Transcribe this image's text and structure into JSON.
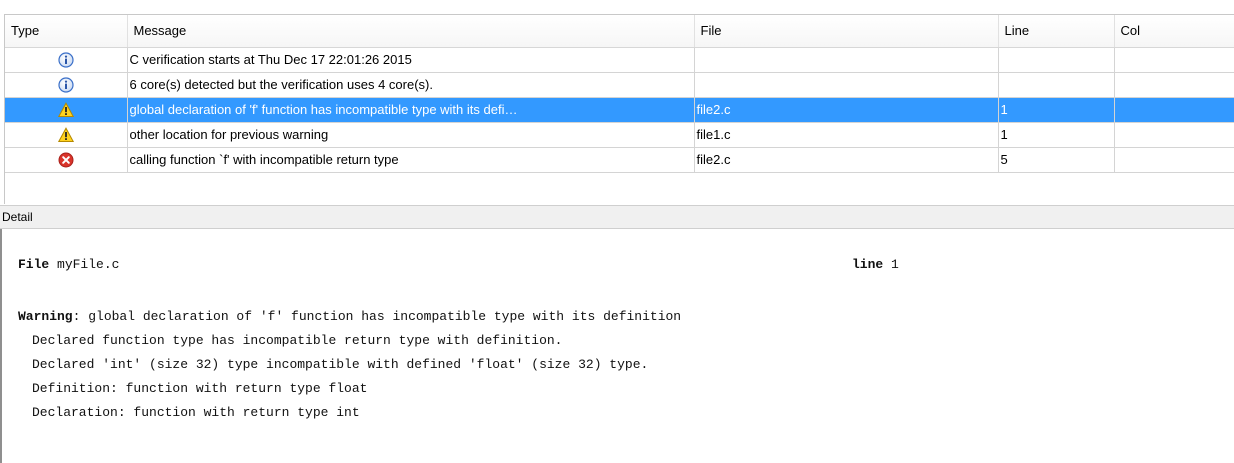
{
  "table": {
    "headers": {
      "type": "Type",
      "message": "Message",
      "file": "File",
      "line": "Line",
      "col": "Col"
    },
    "rows": [
      {
        "icon": "info-icon",
        "message": "C verification starts at Thu Dec 17 22:01:26 2015",
        "file": "",
        "line": "",
        "col": ""
      },
      {
        "icon": "info-icon",
        "message": "6 core(s) detected but the verification uses 4 core(s).",
        "file": "",
        "line": "",
        "col": ""
      },
      {
        "icon": "warning-icon",
        "message": "global declaration of 'f' function has incompatible type with its defi…",
        "file": "file2.c",
        "line": "1",
        "col": "",
        "selected": true
      },
      {
        "icon": "warning-icon",
        "message": "other location for previous warning",
        "file": "file1.c",
        "line": "1",
        "col": ""
      },
      {
        "icon": "error-icon",
        "message": "calling function `f' with incompatible return type",
        "file": "file2.c",
        "line": "5",
        "col": ""
      }
    ]
  },
  "detail": {
    "label": "Detail",
    "file_label": "File",
    "file_name": "myFile.c",
    "line_label": "line",
    "line_value": "1",
    "warning_label": "Warning",
    "warning_text": ": global declaration of 'f' function has incompatible type with its definition",
    "lines": [
      "Declared function type has incompatible return type with definition.",
      "Declared 'int' (size 32) type incompatible with defined 'float' (size 32) type.",
      "Definition: function with return type float",
      "Declaration: function with return type int"
    ]
  },
  "colors": {
    "selection": "#3399ff",
    "info": "#3a6fc8",
    "warning": "#e8b800",
    "error": "#d9342b"
  }
}
